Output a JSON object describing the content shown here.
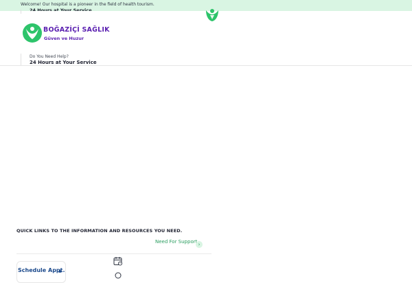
{
  "topbar": {
    "welcome": "Welcome! Our hospital is a pioneer in the field of health tourism.",
    "background": "#d9f5e3"
  },
  "header": {
    "ghost_hours": "24 Hours at Your Service",
    "brand_name": "BOĞAZİÇİ SAĞLIK",
    "brand_tagline": "Güven ve Huzur",
    "brand_color": "#5a1fb0",
    "logo_color": "#2ec46b",
    "logo_icon": "heart-person-logo",
    "help_label": "Do You Need Help?",
    "help_hours": "24 Hours at Your Service"
  },
  "quick_links": {
    "title": "QUICK LINKS TO THE INFORMATION AND RESOURCES YOU NEED.",
    "support_label": "Need For Support",
    "support_icon": "chevron-right-icon",
    "cards": [
      {
        "label": "Schedule Appt.",
        "icon": "calendar-icon"
      }
    ],
    "secondary_icon": "clock-icon",
    "accent": "#2a9d5f"
  }
}
